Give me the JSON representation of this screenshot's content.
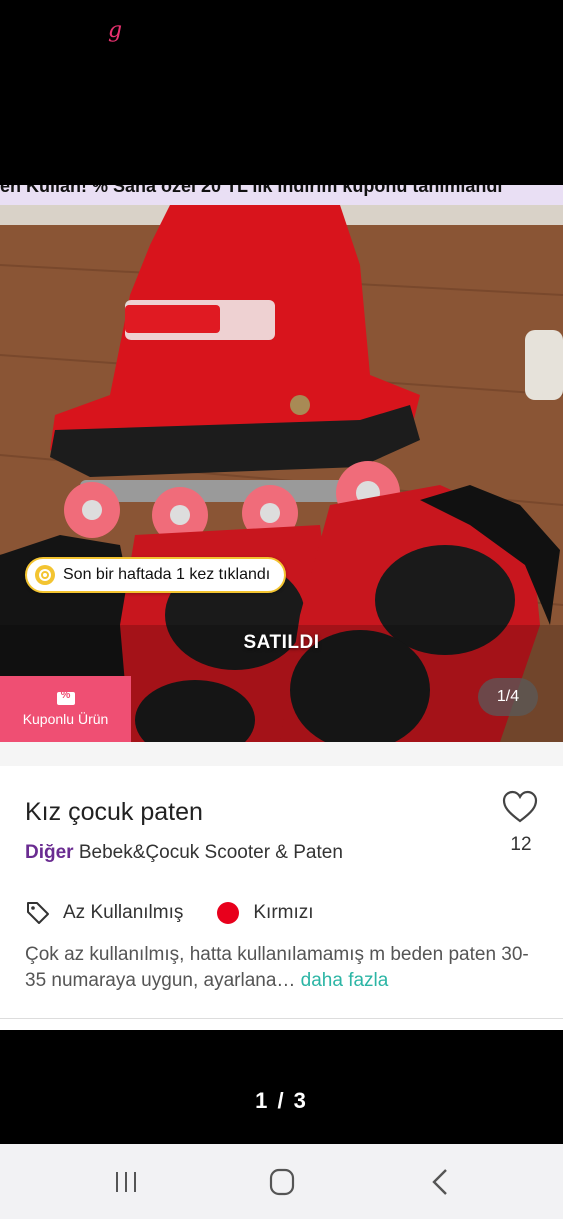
{
  "top": {
    "logo": "g"
  },
  "promo": {
    "text": "en Kullan!   %   Sana özel 20 TL'lik indirim kuponu tanımlandı"
  },
  "photo": {
    "click_notice": "Son bir haftada 1 kez tıklandı",
    "sold_label": "SATILDI",
    "coupon_label": "Kuponlu Ürün",
    "counter": "1/4"
  },
  "listing": {
    "title": "Kız çocuk paten",
    "category_main": "Diğer",
    "category_sub": "Bebek&Çocuk Scooter & Paten",
    "like_count": "12",
    "condition": "Az Kullanılmış",
    "color_name": "Kırmızı",
    "color_hex": "#e8001c",
    "description": "Çok az kullanılmış, hatta kullanılamamış m beden paten 30-35 numaraya uygun, ayarlana",
    "ellipsis": "…",
    "more_link": " daha fazla"
  },
  "pager": {
    "indicator": "1 / 3"
  },
  "navbar": {
    "icons": [
      "recents-icon",
      "home-icon",
      "back-icon"
    ]
  },
  "colors": {
    "accent": "#ef4f73",
    "category": "#6a2c91",
    "link": "#2cb5a5",
    "highlight": "#f3c431"
  }
}
